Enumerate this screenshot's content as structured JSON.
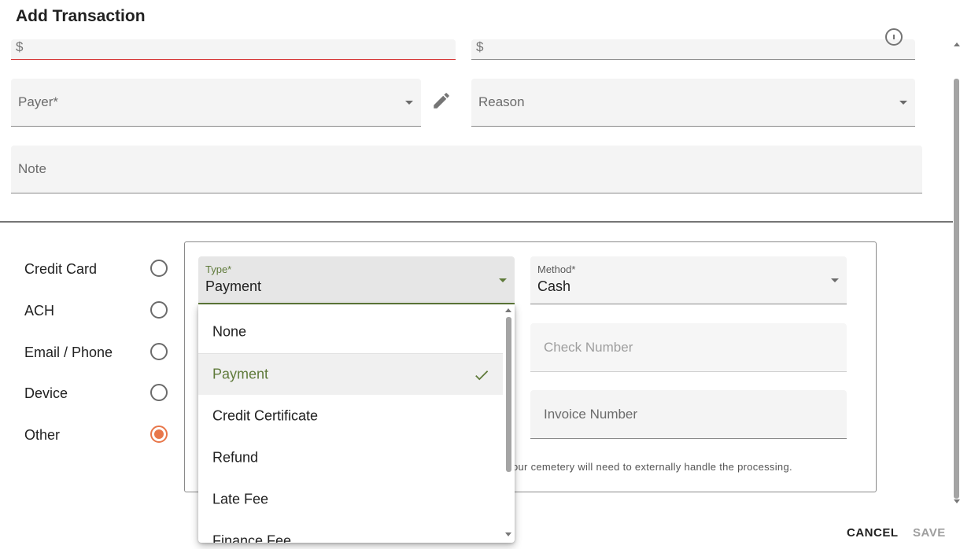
{
  "dialog": {
    "title": "Add Transaction"
  },
  "amount_fields": {
    "left_prefix": "$",
    "right_prefix": "$"
  },
  "payer": {
    "label": "Payer*"
  },
  "reason": {
    "label": "Reason"
  },
  "note": {
    "label": "Note"
  },
  "payment_sources": [
    {
      "label": "Credit Card",
      "checked": false
    },
    {
      "label": "ACH",
      "checked": false
    },
    {
      "label": "Email / Phone",
      "checked": false
    },
    {
      "label": "Device",
      "checked": false
    },
    {
      "label": "Other",
      "checked": true
    }
  ],
  "type_select": {
    "label": "Type*",
    "value": "Payment"
  },
  "method_select": {
    "label": "Method*",
    "value": "Cash"
  },
  "check_number": {
    "label": "Check Number"
  },
  "invoice_number": {
    "label": "Invoice Number"
  },
  "processing_note": "our cemetery will need to externally handle the processing.",
  "type_options": [
    {
      "label": "None",
      "selected": false
    },
    {
      "label": "Payment",
      "selected": true
    },
    {
      "label": "Credit Certificate",
      "selected": false
    },
    {
      "label": "Refund",
      "selected": false
    },
    {
      "label": "Late Fee",
      "selected": false
    },
    {
      "label": "Finance Fee",
      "selected": false
    }
  ],
  "actions": {
    "cancel": "CANCEL",
    "save": "SAVE"
  },
  "colors": {
    "accent": "#e8774a",
    "selected_green": "#5f7a3a",
    "error": "#d32f2f"
  }
}
